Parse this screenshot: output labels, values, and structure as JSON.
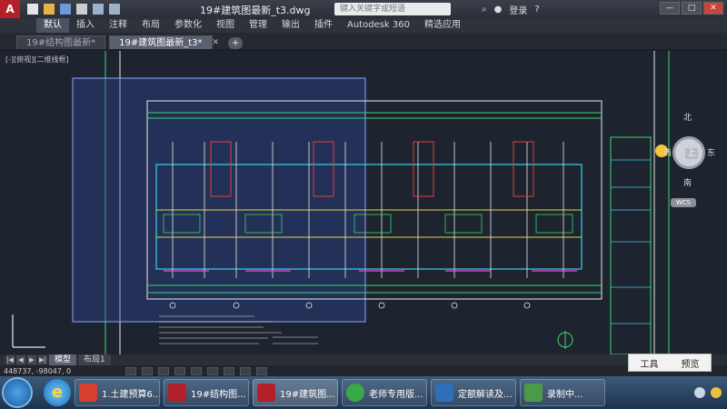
{
  "window": {
    "logo": "A",
    "title": "19#建筑图最新_t3.dwg",
    "search_placeholder": "键入关键字或短语",
    "login": "登录",
    "buttons": {
      "minimize": "—",
      "restore": "□",
      "close": "✕"
    }
  },
  "ribbon": {
    "tabs": [
      "默认",
      "插入",
      "注释",
      "布局",
      "参数化",
      "视图",
      "管理",
      "输出",
      "插件",
      "Autodesk 360",
      "精选应用"
    ]
  },
  "doc_tabs": [
    "19#结构图最新*",
    "19#建筑图最新_t3*"
  ],
  "doc_tabs_close": "✕",
  "viewport_label": "[-][俯视][二维线框]",
  "nav": {
    "north": "北",
    "south": "南",
    "top": "上",
    "west": "西",
    "east": "东",
    "wcs": "WCS"
  },
  "layout_tabs": [
    "模型",
    "布局1"
  ],
  "status": {
    "coords": "448737, -98047, 0"
  },
  "popup": {
    "tools": "工具",
    "preview": "预览"
  },
  "taskbar": {
    "items": [
      {
        "label": "1.土建预算6...",
        "color": "#d6402e",
        "glyph": "P"
      },
      {
        "label": "19#结构图...",
        "color": "#b3202a",
        "glyph": "A"
      },
      {
        "label": "19#建筑图...",
        "color": "#b3202a",
        "glyph": "A"
      },
      {
        "label": "老师专用版...",
        "color": "#3aa845",
        "glyph": "e"
      },
      {
        "label": "定额解读及...",
        "color": "#2f6fb8",
        "glyph": "◆"
      },
      {
        "label": "录制中...",
        "color": "#4a9a4a",
        "glyph": "C"
      }
    ]
  },
  "colors": {
    "canvas_bg": "#1e2330",
    "line_white": "#e8e8e8",
    "line_green": "#3fd46b",
    "line_cyan": "#3ad0e6",
    "line_yellow": "#e6d640",
    "line_magenta": "#e050e0",
    "line_red": "#e0403a",
    "selection": "#2f4aa0"
  }
}
